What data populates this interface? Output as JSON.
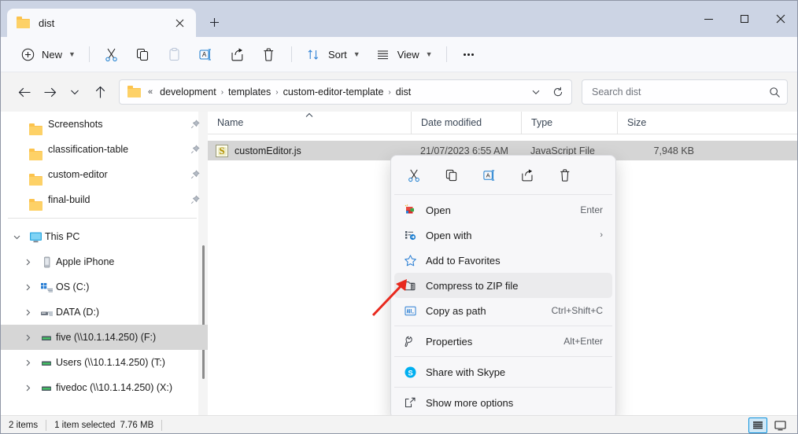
{
  "window": {
    "tab_title": "dist",
    "tab_close_icon": "close-icon",
    "new_tab_icon": "plus-icon",
    "minimize_label": "minimize",
    "maximize_label": "maximize",
    "close_label": "close"
  },
  "toolbar": {
    "new_label": "New",
    "sort_label": "Sort",
    "view_label": "View",
    "more_label": "…",
    "cut_icon": "cut-icon",
    "copy_icon": "copy-icon",
    "paste_icon": "paste-icon",
    "rename_icon": "rename-icon",
    "share_icon": "share-icon",
    "delete_icon": "delete-icon"
  },
  "nav": {
    "back_icon": "back-arrow-icon",
    "forward_icon": "forward-arrow-icon",
    "recent_icon": "chevron-down-icon",
    "up_icon": "up-arrow-icon",
    "refresh_icon": "refresh-icon",
    "dropdown_icon": "chevron-down-icon",
    "breadcrumb_prefix": "«",
    "breadcrumbs": [
      "development",
      "templates",
      "custom-editor-template",
      "dist"
    ],
    "separator": "›"
  },
  "search": {
    "placeholder": "Search dist",
    "value": "",
    "icon": "search-icon"
  },
  "sidebar": {
    "quick_access": [
      {
        "label": "Screenshots",
        "icon": "folder-icon",
        "pinned": true
      },
      {
        "label": "classification-table",
        "icon": "folder-icon",
        "pinned": true
      },
      {
        "label": "custom-editor",
        "icon": "folder-icon",
        "pinned": true
      },
      {
        "label": "final-build",
        "icon": "folder-icon",
        "pinned": true
      }
    ],
    "this_pc": {
      "label": "This PC",
      "icon": "monitor-icon",
      "expanded": true
    },
    "drives": [
      {
        "label": "Apple iPhone",
        "icon": "phone-icon",
        "selected": false
      },
      {
        "label": "OS (C:)",
        "icon": "windows-drive-icon",
        "selected": false
      },
      {
        "label": "DATA (D:)",
        "icon": "drive-icon",
        "selected": false
      },
      {
        "label": "five (\\\\10.1.14.250) (F:)",
        "icon": "network-drive-icon",
        "selected": true
      },
      {
        "label": "Users (\\\\10.1.14.250) (T:)",
        "icon": "network-drive-icon",
        "selected": false
      },
      {
        "label": "fivedoc (\\\\10.1.14.250) (X:)",
        "icon": "network-drive-icon",
        "selected": false
      }
    ]
  },
  "filelist": {
    "columns": [
      "Name",
      "Date modified",
      "Type",
      "Size"
    ],
    "sorted_column": "Name",
    "sort_direction": "asc",
    "rows": [
      {
        "name": "customEditor.js",
        "date_modified": "21/07/2023 6:55 AM",
        "type": "JavaScript File",
        "size": "7,948 KB",
        "icon": "javascript-file-icon",
        "selected": true
      }
    ]
  },
  "context_menu": {
    "icon_row": [
      {
        "icon": "cut-icon",
        "label": "Cut"
      },
      {
        "icon": "copy-icon",
        "label": "Copy"
      },
      {
        "icon": "rename-icon",
        "label": "Rename"
      },
      {
        "icon": "share-icon",
        "label": "Share"
      },
      {
        "icon": "delete-icon",
        "label": "Delete"
      }
    ],
    "items": [
      {
        "label": "Open",
        "accel": "Enter",
        "icon": "open-icon",
        "highlighted": false,
        "submenu": false
      },
      {
        "label": "Open with",
        "accel": "",
        "icon": "open-with-icon",
        "highlighted": false,
        "submenu": true
      },
      {
        "label": "Add to Favorites",
        "accel": "",
        "icon": "star-icon",
        "highlighted": false,
        "submenu": false
      },
      {
        "label": "Compress to ZIP file",
        "accel": "",
        "icon": "zip-icon",
        "highlighted": true,
        "submenu": false
      },
      {
        "label": "Copy as path",
        "accel": "Ctrl+Shift+C",
        "icon": "copy-path-icon",
        "highlighted": false,
        "submenu": false
      },
      {
        "label": "Properties",
        "accel": "Alt+Enter",
        "icon": "wrench-icon",
        "highlighted": false,
        "submenu": false
      },
      {
        "label": "Share with Skype",
        "accel": "",
        "icon": "skype-icon",
        "highlighted": false,
        "submenu": false
      },
      {
        "label": "Show more options",
        "accel": "",
        "icon": "more-options-icon",
        "highlighted": false,
        "submenu": false
      }
    ],
    "submenu_arrow": "›"
  },
  "statusbar": {
    "item_count": "2 items",
    "selection": "1 item selected",
    "selection_size": "7.76 MB",
    "details_view_icon": "details-view-icon",
    "large_icons_view_icon": "large-icons-view-icon",
    "active_view": "details"
  },
  "annotation": {
    "arrow_color": "#e8291e",
    "points_to": "Compress to ZIP file"
  },
  "colors": {
    "accent": "#0f93dd",
    "titlebar": "#ccd4e4",
    "folder": "#fcc34d",
    "selection": "#d5d5d5"
  }
}
